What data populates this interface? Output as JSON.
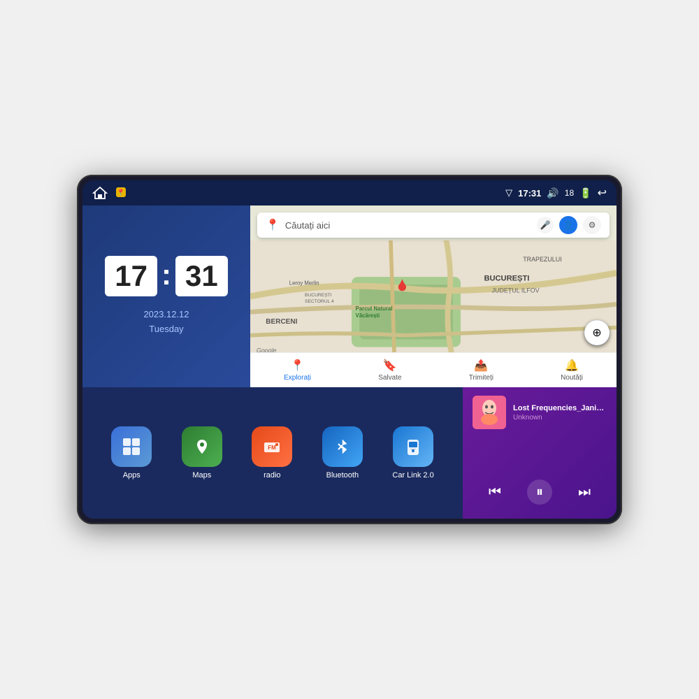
{
  "device": {
    "status_bar": {
      "time": "17:31",
      "signal_icon": "▽",
      "volume_icon": "🔊",
      "battery_level": "18",
      "battery_icon": "🔋",
      "back_icon": "↩"
    },
    "clock": {
      "hours": "17",
      "minutes": "31",
      "date": "2023.12.12",
      "day": "Tuesday"
    },
    "map": {
      "search_placeholder": "Căutați aici",
      "logo": "Google",
      "nav_items": [
        {
          "label": "Explorați",
          "active": true
        },
        {
          "label": "Salvate",
          "active": false
        },
        {
          "label": "Trimiteți",
          "active": false
        },
        {
          "label": "Noutăți",
          "active": false
        }
      ],
      "map_labels": [
        "BUCUREȘTI",
        "JUDEȚUL ILFOV",
        "TRAPEZULUI",
        "BERCENI",
        "Parcul Natural Văcărești",
        "Leroy Merlin",
        "BUCUREȘTI SECTORUL 4"
      ]
    },
    "apps": [
      {
        "id": "apps",
        "label": "Apps",
        "icon_class": "app-icon-apps",
        "icon": "⊞"
      },
      {
        "id": "maps",
        "label": "Maps",
        "icon_class": "app-icon-maps",
        "icon": "📍"
      },
      {
        "id": "radio",
        "label": "radio",
        "icon_class": "app-icon-radio",
        "icon": "📻"
      },
      {
        "id": "bluetooth",
        "label": "Bluetooth",
        "icon_class": "app-icon-bluetooth",
        "icon": "₿"
      },
      {
        "id": "carlink",
        "label": "Car Link 2.0",
        "icon_class": "app-icon-carlink",
        "icon": "📱"
      }
    ],
    "music": {
      "title": "Lost Frequencies_Janieck Devy-...",
      "artist": "Unknown",
      "prev_icon": "⏮",
      "play_icon": "⏸",
      "next_icon": "⏭"
    }
  }
}
